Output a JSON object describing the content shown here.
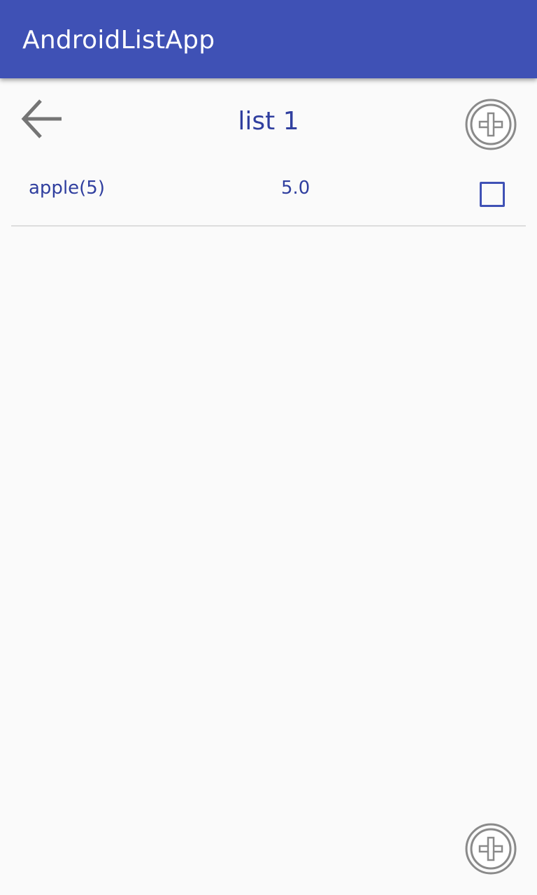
{
  "app_bar": {
    "title": "AndroidListApp",
    "color": "#3f51b5"
  },
  "header": {
    "back_icon": "arrow-left-icon",
    "list_title": "list 1",
    "add_icon": "circle-plus-icon"
  },
  "items": [
    {
      "name": "apple(5)",
      "value": "5.0",
      "checked": false
    }
  ],
  "footer": {
    "add_icon": "circle-plus-icon"
  },
  "colors": {
    "accent": "#303f9f",
    "background": "#fafafa",
    "icon_gray": "#757575"
  }
}
